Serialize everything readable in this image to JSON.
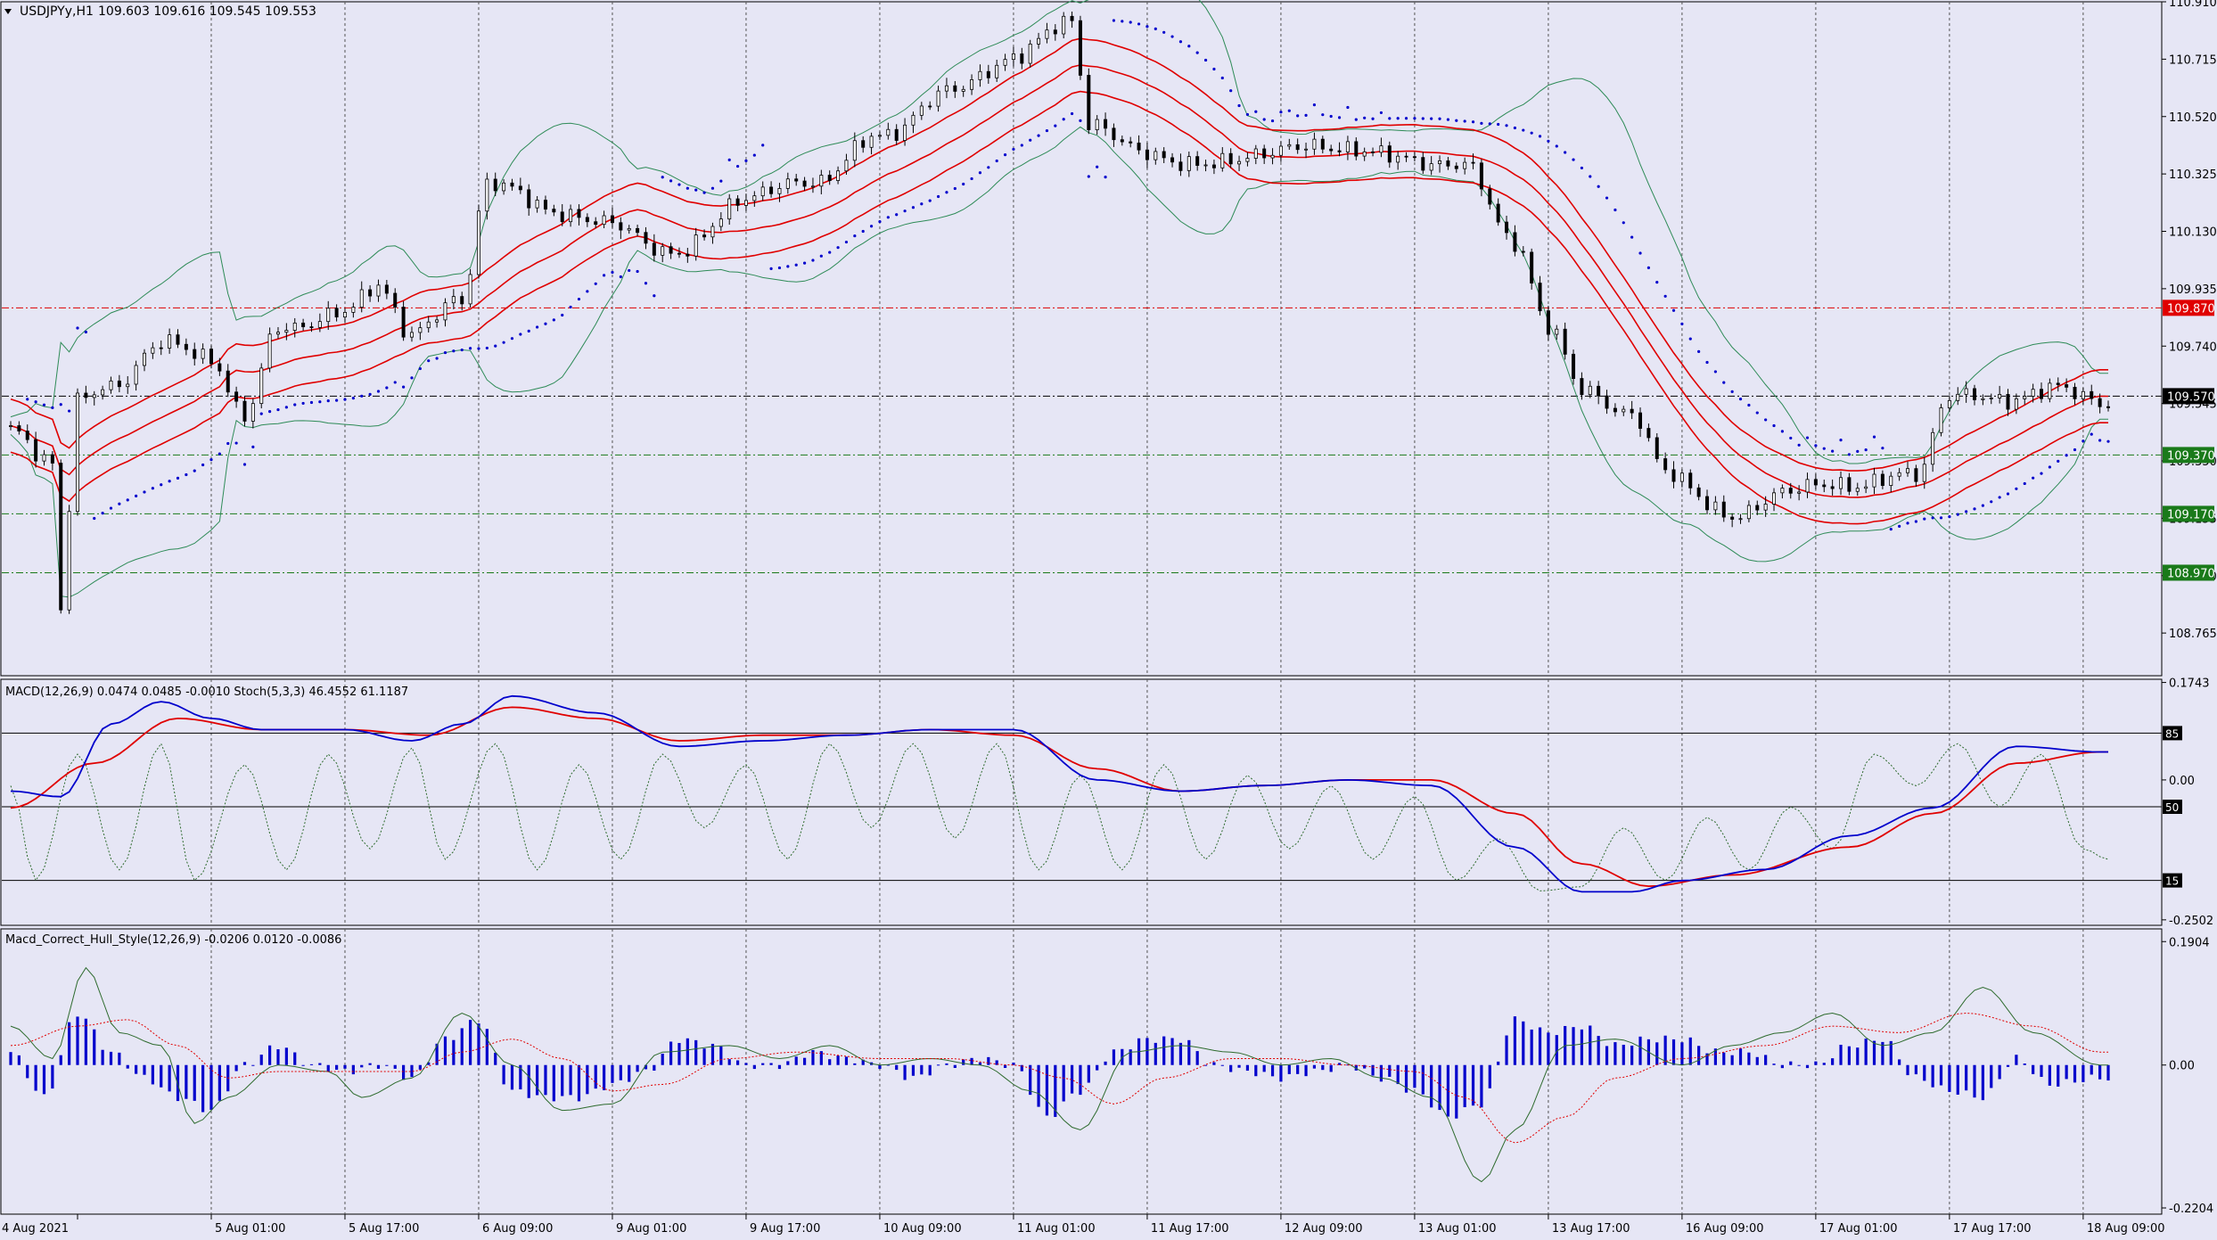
{
  "header": {
    "title": "USDJPYy,H1",
    "ohlc": "109.603 109.616 109.545 109.553"
  },
  "colors": {
    "background": "#e6e6f5",
    "grid": "#555555",
    "bollinger": "#2e8b57",
    "envelope": "#e00000",
    "sar": "#0000cc",
    "candle_bull": "#ffffff",
    "candle_bear": "#000000",
    "macd_main": "#0000cc",
    "macd_signal": "#e00000",
    "stoch": "#2e6b2e",
    "hist": "#0000cc",
    "level_red": "#dd0000",
    "level_green": "#1a7a1a"
  },
  "chart_data": [
    {
      "type": "candlestick",
      "name": "main",
      "symbol": "USDJPYy",
      "timeframe": "H1",
      "ylim": [
        108.62,
        110.91
      ],
      "y_ticks": [
        "110.910",
        "110.715",
        "110.520",
        "110.325",
        "110.130",
        "109.935",
        "109.740",
        "109.545",
        "109.350",
        "109.155",
        "108.960",
        "108.765"
      ],
      "x_labels": [
        "4 Aug 2021",
        "5 Aug 01:00",
        "5 Aug 17:00",
        "6 Aug 09:00",
        "9 Aug 01:00",
        "9 Aug 17:00",
        "10 Aug 09:00",
        "11 Aug 01:00",
        "11 Aug 17:00",
        "12 Aug 09:00",
        "13 Aug 01:00",
        "13 Aug 17:00",
        "16 Aug 09:00",
        "17 Aug 01:00",
        "17 Aug 17:00",
        "18 Aug 09:00"
      ],
      "close_keypoints": [
        [
          0,
          109.45
        ],
        [
          5,
          109.35
        ],
        [
          6,
          108.85
        ],
        [
          8,
          109.55
        ],
        [
          12,
          109.6
        ],
        [
          18,
          109.75
        ],
        [
          24,
          109.7
        ],
        [
          28,
          109.5
        ],
        [
          32,
          109.8
        ],
        [
          40,
          109.85
        ],
        [
          44,
          109.95
        ],
        [
          48,
          109.78
        ],
        [
          54,
          109.9
        ],
        [
          57,
          110.3
        ],
        [
          65,
          110.2
        ],
        [
          72,
          110.15
        ],
        [
          80,
          110.05
        ],
        [
          88,
          110.25
        ],
        [
          96,
          110.3
        ],
        [
          104,
          110.45
        ],
        [
          112,
          110.6
        ],
        [
          120,
          110.72
        ],
        [
          127,
          110.85
        ],
        [
          129,
          110.5
        ],
        [
          135,
          110.4
        ],
        [
          143,
          110.35
        ],
        [
          150,
          110.4
        ],
        [
          158,
          110.42
        ],
        [
          166,
          110.38
        ],
        [
          174,
          110.35
        ],
        [
          180,
          110.1
        ],
        [
          184,
          109.8
        ],
        [
          188,
          109.6
        ],
        [
          194,
          109.5
        ],
        [
          198,
          109.32
        ],
        [
          206,
          109.15
        ],
        [
          212,
          109.25
        ],
        [
          220,
          109.27
        ],
        [
          228,
          109.3
        ],
        [
          232,
          109.58
        ],
        [
          238,
          109.55
        ],
        [
          244,
          109.6
        ],
        [
          250,
          109.55
        ]
      ],
      "levels": [
        {
          "value": "109.870",
          "color": "red",
          "style": "dash-dot"
        },
        {
          "value": "109.570",
          "color": "black",
          "style": "dash-dot"
        },
        {
          "value": "109.370",
          "color": "green",
          "style": "dash-dot"
        },
        {
          "value": "109.170",
          "color": "green",
          "style": "dash-dot"
        },
        {
          "value": "108.970",
          "color": "green",
          "style": "dash-dot"
        }
      ],
      "overlays": [
        "Bollinger Bands",
        "Moving Average Envelope",
        "Parabolic SAR"
      ]
    },
    {
      "type": "line",
      "name": "macd-stoch",
      "label": "MACD(12,26,9) 0.0474 0.0485 -0.0010  Stoch(5,3,3) 46.4552 61.1187",
      "ylim": [
        -0.26,
        0.18
      ],
      "y_ticks": [
        "0.1743",
        "0.00",
        "-0.2502"
      ],
      "stoch_levels": [
        "85",
        "50",
        "15"
      ],
      "macd_keypoints": [
        [
          0,
          -0.02
        ],
        [
          6,
          -0.03
        ],
        [
          12,
          0.1
        ],
        [
          18,
          0.14
        ],
        [
          24,
          0.11
        ],
        [
          30,
          0.09
        ],
        [
          40,
          0.09
        ],
        [
          48,
          0.07
        ],
        [
          54,
          0.1
        ],
        [
          60,
          0.15
        ],
        [
          70,
          0.12
        ],
        [
          80,
          0.06
        ],
        [
          90,
          0.07
        ],
        [
          100,
          0.08
        ],
        [
          110,
          0.09
        ],
        [
          120,
          0.09
        ],
        [
          130,
          0.0
        ],
        [
          140,
          -0.02
        ],
        [
          150,
          -0.01
        ],
        [
          160,
          0.0
        ],
        [
          170,
          -0.01
        ],
        [
          180,
          -0.12
        ],
        [
          188,
          -0.2
        ],
        [
          194,
          -0.2
        ],
        [
          200,
          -0.18
        ],
        [
          210,
          -0.16
        ],
        [
          220,
          -0.1
        ],
        [
          230,
          -0.05
        ],
        [
          240,
          0.06
        ],
        [
          250,
          0.05
        ]
      ],
      "signal_keypoints": [
        [
          0,
          -0.05
        ],
        [
          10,
          0.03
        ],
        [
          20,
          0.11
        ],
        [
          30,
          0.09
        ],
        [
          40,
          0.09
        ],
        [
          50,
          0.08
        ],
        [
          60,
          0.13
        ],
        [
          70,
          0.11
        ],
        [
          80,
          0.07
        ],
        [
          90,
          0.08
        ],
        [
          100,
          0.08
        ],
        [
          110,
          0.09
        ],
        [
          120,
          0.08
        ],
        [
          130,
          0.02
        ],
        [
          140,
          -0.02
        ],
        [
          150,
          -0.01
        ],
        [
          160,
          0.0
        ],
        [
          170,
          0.0
        ],
        [
          180,
          -0.06
        ],
        [
          188,
          -0.15
        ],
        [
          196,
          -0.19
        ],
        [
          206,
          -0.17
        ],
        [
          220,
          -0.12
        ],
        [
          230,
          -0.06
        ],
        [
          240,
          0.03
        ],
        [
          250,
          0.05
        ]
      ],
      "stoch_keypoints": [
        [
          0,
          60
        ],
        [
          3,
          15
        ],
        [
          8,
          75
        ],
        [
          13,
          20
        ],
        [
          18,
          80
        ],
        [
          22,
          15
        ],
        [
          28,
          70
        ],
        [
          33,
          20
        ],
        [
          38,
          75
        ],
        [
          43,
          30
        ],
        [
          48,
          78
        ],
        [
          52,
          25
        ],
        [
          58,
          80
        ],
        [
          63,
          20
        ],
        [
          68,
          70
        ],
        [
          73,
          25
        ],
        [
          78,
          75
        ],
        [
          83,
          40
        ],
        [
          88,
          70
        ],
        [
          93,
          25
        ],
        [
          98,
          80
        ],
        [
          103,
          40
        ],
        [
          108,
          80
        ],
        [
          113,
          35
        ],
        [
          118,
          80
        ],
        [
          123,
          20
        ],
        [
          128,
          65
        ],
        [
          133,
          20
        ],
        [
          138,
          70
        ],
        [
          143,
          25
        ],
        [
          148,
          65
        ],
        [
          153,
          30
        ],
        [
          158,
          60
        ],
        [
          163,
          25
        ],
        [
          168,
          55
        ],
        [
          173,
          15
        ],
        [
          178,
          35
        ],
        [
          183,
          10
        ],
        [
          188,
          12
        ],
        [
          193,
          40
        ],
        [
          198,
          15
        ],
        [
          203,
          45
        ],
        [
          208,
          20
        ],
        [
          213,
          50
        ],
        [
          218,
          30
        ],
        [
          223,
          75
        ],
        [
          228,
          60
        ],
        [
          233,
          80
        ],
        [
          238,
          50
        ],
        [
          243,
          75
        ],
        [
          248,
          30
        ],
        [
          251,
          25
        ]
      ]
    },
    {
      "type": "bar",
      "name": "macd-hull",
      "label": "Macd_Correct_Hull_Style(12,26,9) -0.0206 0.0120 -0.0086",
      "ylim": [
        -0.23,
        0.21
      ],
      "y_ticks": [
        "0.1904",
        "0.00",
        "-0.2204"
      ],
      "hist_keypoints": [
        [
          0,
          0.02
        ],
        [
          4,
          -0.05
        ],
        [
          8,
          0.08
        ],
        [
          12,
          0.02
        ],
        [
          16,
          -0.02
        ],
        [
          20,
          -0.05
        ],
        [
          24,
          -0.07
        ],
        [
          28,
          0.0
        ],
        [
          32,
          0.03
        ],
        [
          36,
          0.0
        ],
        [
          40,
          -0.01
        ],
        [
          44,
          0.0
        ],
        [
          48,
          -0.02
        ],
        [
          52,
          0.04
        ],
        [
          56,
          0.07
        ],
        [
          60,
          -0.04
        ],
        [
          64,
          -0.05
        ],
        [
          68,
          -0.05
        ],
        [
          72,
          -0.03
        ],
        [
          76,
          -0.01
        ],
        [
          80,
          0.04
        ],
        [
          84,
          0.03
        ],
        [
          88,
          0.0
        ],
        [
          92,
          0.0
        ],
        [
          96,
          0.02
        ],
        [
          100,
          0.01
        ],
        [
          104,
          0.0
        ],
        [
          108,
          -0.02
        ],
        [
          112,
          0.0
        ],
        [
          116,
          0.01
        ],
        [
          120,
          0.0
        ],
        [
          124,
          -0.08
        ],
        [
          128,
          -0.04
        ],
        [
          132,
          0.02
        ],
        [
          136,
          0.04
        ],
        [
          140,
          0.04
        ],
        [
          144,
          0.0
        ],
        [
          148,
          -0.01
        ],
        [
          152,
          -0.02
        ],
        [
          156,
          -0.01
        ],
        [
          160,
          0.0
        ],
        [
          164,
          -0.02
        ],
        [
          168,
          -0.04
        ],
        [
          172,
          -0.08
        ],
        [
          176,
          -0.06
        ],
        [
          180,
          0.07
        ],
        [
          184,
          0.05
        ],
        [
          188,
          0.06
        ],
        [
          192,
          0.03
        ],
        [
          196,
          0.04
        ],
        [
          200,
          0.04
        ],
        [
          204,
          0.02
        ],
        [
          208,
          0.02
        ],
        [
          212,
          0.0
        ],
        [
          216,
          0.0
        ],
        [
          220,
          0.03
        ],
        [
          224,
          0.04
        ],
        [
          228,
          -0.02
        ],
        [
          232,
          -0.04
        ],
        [
          236,
          -0.05
        ],
        [
          240,
          0.01
        ],
        [
          244,
          -0.03
        ],
        [
          250,
          -0.02
        ]
      ],
      "line_keypoints": [
        [
          0,
          0.06
        ],
        [
          5,
          0.01
        ],
        [
          9,
          0.15
        ],
        [
          13,
          0.05
        ],
        [
          18,
          0.03
        ],
        [
          22,
          -0.09
        ],
        [
          26,
          -0.05
        ],
        [
          32,
          0.0
        ],
        [
          38,
          -0.01
        ],
        [
          42,
          -0.05
        ],
        [
          48,
          -0.02
        ],
        [
          54,
          0.08
        ],
        [
          60,
          0.0
        ],
        [
          66,
          -0.07
        ],
        [
          72,
          -0.06
        ],
        [
          78,
          0.02
        ],
        [
          86,
          0.03
        ],
        [
          92,
          0.01
        ],
        [
          98,
          0.03
        ],
        [
          104,
          0.0
        ],
        [
          110,
          0.01
        ],
        [
          116,
          0.0
        ],
        [
          122,
          -0.04
        ],
        [
          128,
          -0.1
        ],
        [
          134,
          0.02
        ],
        [
          140,
          0.03
        ],
        [
          146,
          0.02
        ],
        [
          152,
          0.0
        ],
        [
          158,
          0.01
        ],
        [
          164,
          -0.02
        ],
        [
          170,
          -0.05
        ],
        [
          176,
          -0.18
        ],
        [
          180,
          -0.1
        ],
        [
          186,
          0.03
        ],
        [
          192,
          0.04
        ],
        [
          200,
          0.0
        ],
        [
          206,
          0.03
        ],
        [
          212,
          0.05
        ],
        [
          218,
          0.08
        ],
        [
          224,
          0.03
        ],
        [
          230,
          0.05
        ],
        [
          236,
          0.12
        ],
        [
          242,
          0.05
        ],
        [
          250,
          0.0
        ]
      ],
      "signal_keypoints": [
        [
          0,
          0.03
        ],
        [
          8,
          0.06
        ],
        [
          14,
          0.07
        ],
        [
          20,
          0.03
        ],
        [
          26,
          -0.02
        ],
        [
          32,
          -0.01
        ],
        [
          40,
          -0.01
        ],
        [
          48,
          -0.01
        ],
        [
          54,
          0.02
        ],
        [
          60,
          0.04
        ],
        [
          66,
          0.01
        ],
        [
          72,
          -0.04
        ],
        [
          78,
          -0.03
        ],
        [
          86,
          0.01
        ],
        [
          94,
          0.02
        ],
        [
          104,
          0.01
        ],
        [
          112,
          0.01
        ],
        [
          120,
          0.0
        ],
        [
          126,
          -0.02
        ],
        [
          132,
          -0.06
        ],
        [
          138,
          -0.02
        ],
        [
          146,
          0.01
        ],
        [
          152,
          0.01
        ],
        [
          160,
          0.0
        ],
        [
          168,
          -0.01
        ],
        [
          174,
          -0.05
        ],
        [
          180,
          -0.12
        ],
        [
          186,
          -0.08
        ],
        [
          192,
          -0.02
        ],
        [
          200,
          0.01
        ],
        [
          210,
          0.03
        ],
        [
          218,
          0.06
        ],
        [
          226,
          0.05
        ],
        [
          234,
          0.08
        ],
        [
          242,
          0.06
        ],
        [
          250,
          0.02
        ]
      ]
    }
  ]
}
